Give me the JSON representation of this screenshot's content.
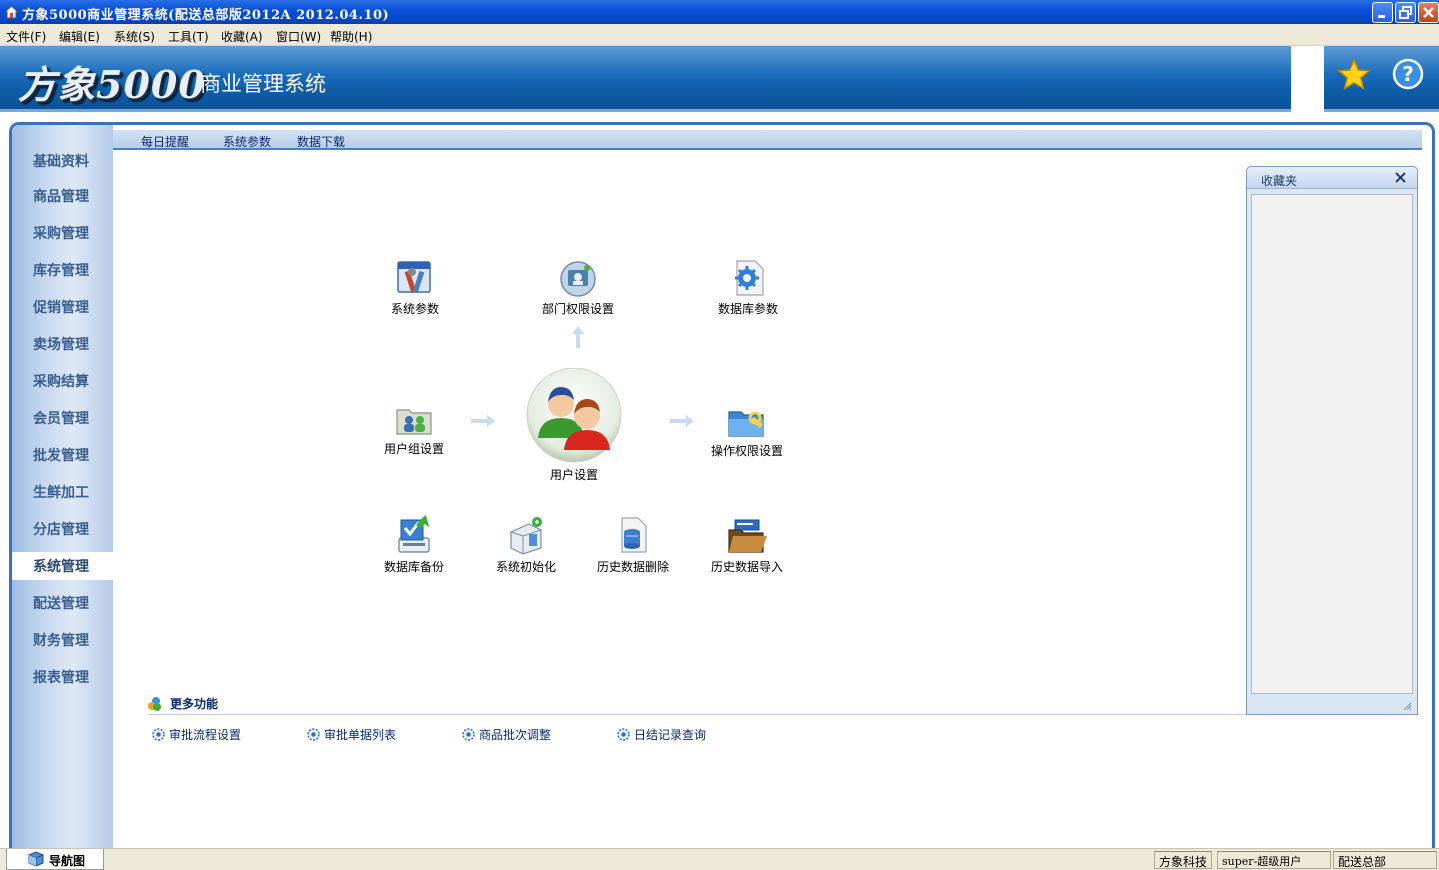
{
  "window": {
    "title": "方象5000商业管理系统(配送总部版2012A  2012.04.10)"
  },
  "menu": {
    "items": [
      "文件(F)",
      "编辑(E)",
      "系统(S)",
      "工具(T)",
      "收藏(A)",
      "窗口(W)",
      "帮助(H)"
    ]
  },
  "banner": {
    "brand": "方象5000",
    "subtitle": "商业管理系统"
  },
  "sidebar": {
    "items": [
      "基础资料",
      "商品管理",
      "采购管理",
      "库存管理",
      "促销管理",
      "卖场管理",
      "采购结算",
      "会员管理",
      "批发管理",
      "生鲜加工",
      "分店管理",
      "系统管理",
      "配送管理",
      "财务管理",
      "报表管理"
    ],
    "active": "系统管理"
  },
  "tabs": [
    "每日提醒",
    "系统参数",
    "数据下载"
  ],
  "functions": {
    "sys_params": "系统参数",
    "dept_perm": "部门权限设置",
    "db_params": "数据库参数",
    "usergroup": "用户组设置",
    "user": "用户设置",
    "op_perm": "操作权限设置",
    "db_backup": "数据库备份",
    "sys_init": "系统初始化",
    "hist_delete": "历史数据删除",
    "hist_import": "历史数据导入"
  },
  "more": {
    "title": "更多功能",
    "links": [
      "审批流程设置",
      "审批单据列表",
      "商品批次调整",
      "日结记录查询"
    ]
  },
  "favorites": {
    "title": "收藏夹"
  },
  "statusbar": {
    "nav_tab": "导航图",
    "company": "方象科技",
    "user": "super-超级用户",
    "branch": "配送总部"
  },
  "colors": {
    "banner": "#1c6fbe",
    "frame_border": "#3b72b6",
    "sidebar_text": "#3a5f8f",
    "link_text": "#0b2a73"
  }
}
